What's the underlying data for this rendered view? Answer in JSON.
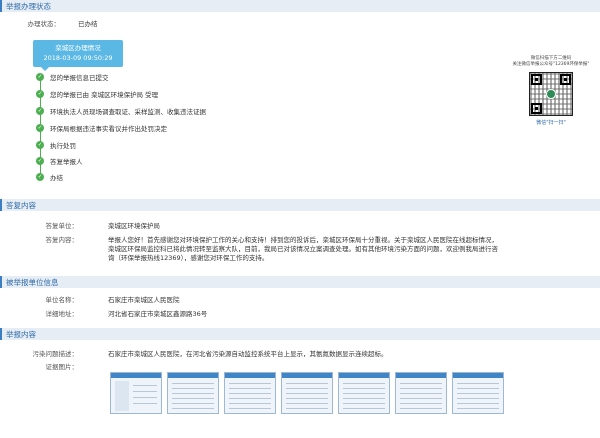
{
  "sections": {
    "progress": "举报办理状态",
    "reply": "答复内容",
    "unit": "被举报单位信息",
    "report": "举报内容"
  },
  "progress": {
    "status_label": "办理状态：",
    "status_value": "已办结",
    "box_title": "栾城区办理情况",
    "box_time": "2018-03-09 09:50:29",
    "steps": [
      "您的举报信息已提交",
      "您的举报已由 栾城区环境保护局 受理",
      "环境执法人员现场调查取证、采样监测、收集违法证据",
      "环保局根据违法事实看议并作出处罚决定",
      "执行处罚",
      "答复举报人",
      "办结"
    ]
  },
  "qr": {
    "line1": "微信扫描下方二维码",
    "line2": "关注微信举报公众号\"12369环保举报\"",
    "caption": "微信\"扫一扫\""
  },
  "reply": {
    "unit_label": "答复单位：",
    "unit_value": "栾城区环境保护局",
    "content_label": "答复内容：",
    "content_line1": "举报人您好！首先感谢您对环境保护工作的关心和支持！排到您的投诉后，栾城区环保局十分重视。关于栾城区人民医院在线超标情况，",
    "content_line2": "栾城区环保局监控科已将此情况转至监察大队，目前，我局已对该情况立案调查处理。如有其他环境污染方面的问题，欢迎例我局进行咨",
    "content_line3": "询（环保举报热线12369），感谢您对环保工作的支持。"
  },
  "unit": {
    "name_label": "单位名称：",
    "name_value": "石家庄市栾城区人民医院",
    "address_label": "详细地址：",
    "address_value": "河北省石家庄市栾城区鑫源路36号"
  },
  "report": {
    "desc_label": "污染问题描述：",
    "desc_value": "石家庄市栾城区人民医院，在河北省污染源自动监控系统平台上显示，其氨氮数据显示连续超标。",
    "photo_label": "证据图片："
  }
}
